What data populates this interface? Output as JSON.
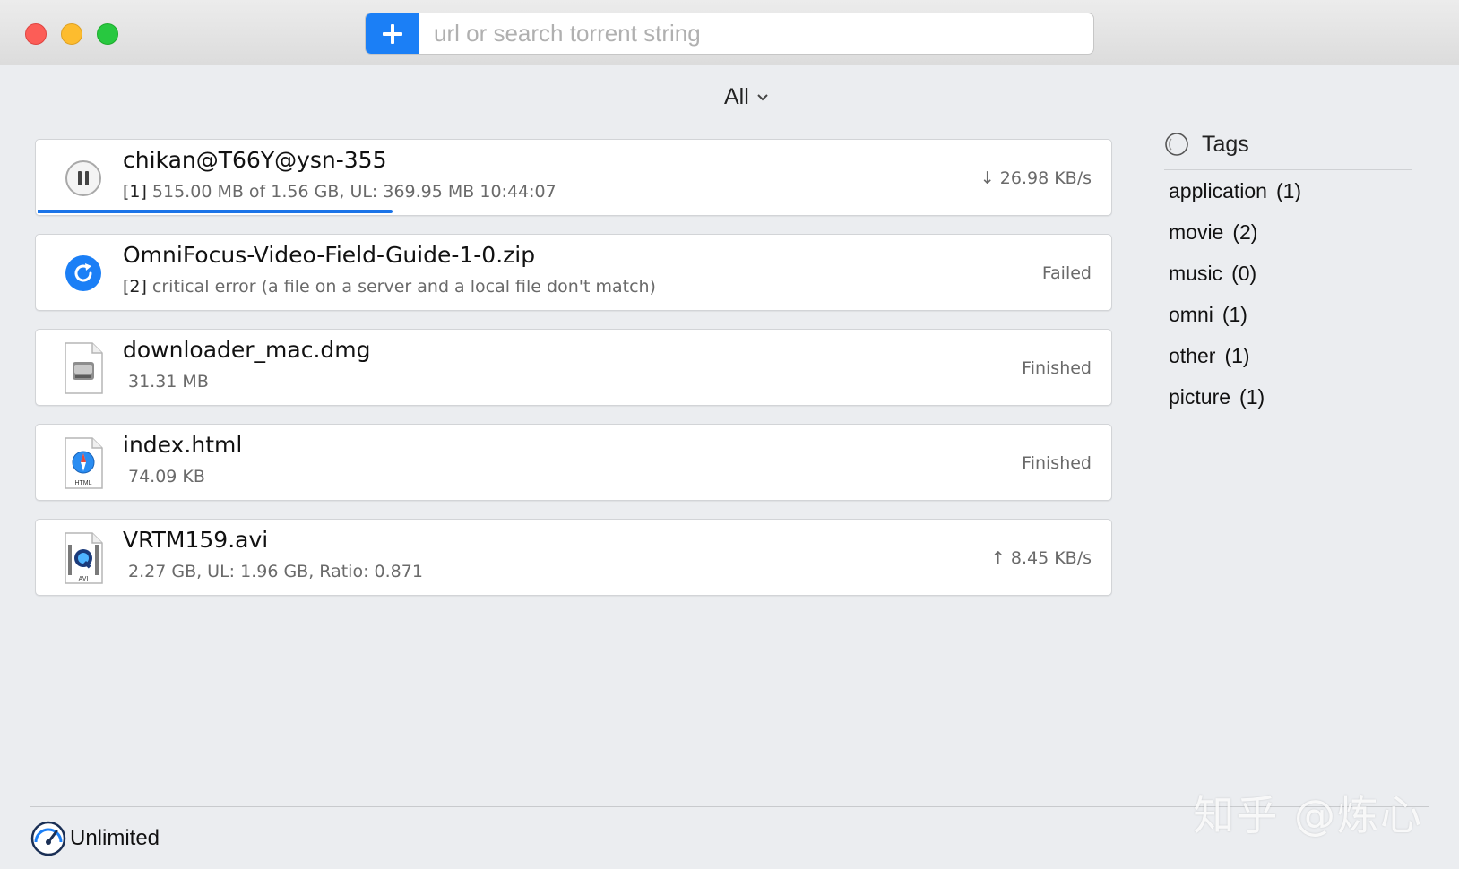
{
  "toolbar": {
    "add_icon": "plus-icon",
    "search_placeholder": "url or search torrent string"
  },
  "filter": {
    "label": "All"
  },
  "downloads": [
    {
      "title": "chikan@T66Y@ysn-355",
      "index": "[1]",
      "detail": "515.00 MB of 1.56 GB, UL: 369.95 MB 10:44:07",
      "status": "↓ 26.98 KB/s",
      "icon": "pause-icon",
      "progress": 0.33
    },
    {
      "title": "OmniFocus-Video-Field-Guide-1-0.zip",
      "index": "[2]",
      "detail": "critical error (a file on a server and a local file  don't match)",
      "status": "Failed",
      "icon": "retry-icon"
    },
    {
      "title": "downloader_mac.dmg",
      "index": "",
      "detail": "31.31 MB",
      "status": "Finished",
      "icon": "disk-image-file-icon"
    },
    {
      "title": "index.html",
      "index": "",
      "detail": "74.09 KB",
      "status": "Finished",
      "icon": "html-file-icon",
      "icon_label": "HTML"
    },
    {
      "title": "VRTM159.avi",
      "index": "",
      "detail": "2.27 GB, UL: 1.96 GB, Ratio: 0.871",
      "status": "↑ 8.45 KB/s",
      "icon": "avi-file-icon",
      "icon_label": "AVI"
    }
  ],
  "tags": {
    "header": "Tags",
    "items": [
      {
        "name": "application",
        "count": "(1)"
      },
      {
        "name": "movie",
        "count": "(2)"
      },
      {
        "name": "music",
        "count": "(0)"
      },
      {
        "name": "omni",
        "count": "(1)"
      },
      {
        "name": "other",
        "count": "(1)"
      },
      {
        "name": "picture",
        "count": "(1)"
      }
    ]
  },
  "footer": {
    "speed_limit": "Unlimited",
    "watermark": "知乎 @炼心"
  },
  "colors": {
    "accent": "#1b7ff6",
    "progress": "#1b74e8",
    "close": "#fc5d57",
    "minimize": "#fdbc2e",
    "zoom": "#28c840"
  }
}
